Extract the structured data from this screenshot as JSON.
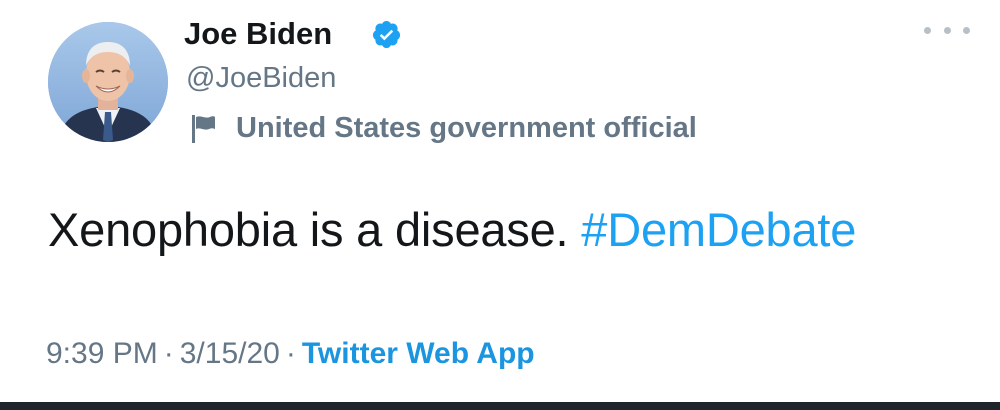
{
  "author": {
    "display_name": "Joe Biden",
    "handle": "@JoeBiden",
    "verified_icon": "verified-badge-icon",
    "label_icon": "flag-icon",
    "label": "United States government official"
  },
  "tweet": {
    "text": "Xenophobia is a disease.",
    "hashtag": "#DemDebate",
    "time": "9:39 PM",
    "separator": "·",
    "date": "3/15/20",
    "source": "Twitter Web App"
  },
  "menu": {
    "icon": "more-options-icon"
  },
  "colors": {
    "link": "#1da1f2",
    "secondary_text": "#657786",
    "primary_text": "#14171a",
    "verified": "#1da1f2"
  }
}
